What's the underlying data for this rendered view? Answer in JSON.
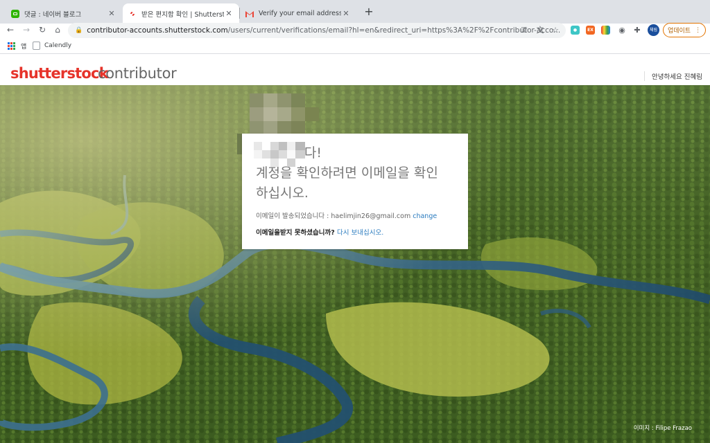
{
  "browser": {
    "tabs": [
      {
        "title": "댓글 : 네이버 블로그",
        "active": false
      },
      {
        "title": "받은 편지함 확인 | Shutterstock",
        "active": true
      },
      {
        "title": "Verify your email address - hae",
        "active": false
      }
    ],
    "url_host": "contributor-accounts.shutterstock.com",
    "url_path": "/users/current/verifications/email?hl=en&redirect_uri=https%3A%2F%2Fcontributor-acco...",
    "profile_initials": "체림",
    "update_label": "업데이트",
    "bookmarks": [
      {
        "label": "앱"
      },
      {
        "label": "Calendly"
      }
    ]
  },
  "site": {
    "logo_brand": "shutterstock",
    "logo_sub": "contributor",
    "greeting": "안녕하세요 진혜림"
  },
  "card": {
    "heading_line1": "감사합니다!",
    "heading_line2": "계정을 확인하려면 이메일을 확인",
    "heading_line3": "하십시오.",
    "sent_prefix": "이메일이 발송되었습니다 : haelimjin26@gmail.com",
    "change_link": "change",
    "resend_prefix": "이메일을받지 못하셨습니까?",
    "resend_link": "다시 보내십시오."
  },
  "hero": {
    "credit": "이미지 : Filipe Frazao"
  },
  "colors": {
    "brand_red": "#e6332a",
    "link_blue": "#2a7bbf",
    "update_orange": "#e37400"
  },
  "icons": [
    "back-arrow-icon",
    "forward-arrow-icon",
    "reload-icon",
    "home-icon",
    "lock-icon",
    "key-icon",
    "translate-icon",
    "star-icon",
    "extensions-icon",
    "camera-icon",
    "more-icon",
    "close-icon",
    "plus-icon"
  ]
}
